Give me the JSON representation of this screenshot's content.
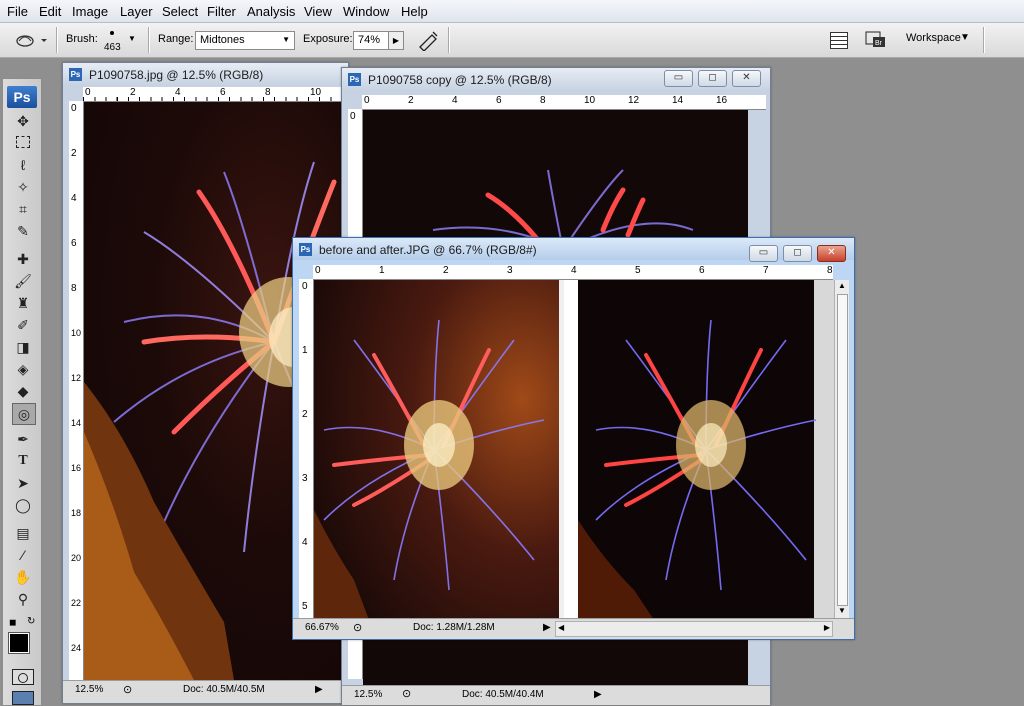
{
  "menu": [
    "File",
    "Edit",
    "Image",
    "Layer",
    "Select",
    "Filter",
    "Analysis",
    "View",
    "Window",
    "Help"
  ],
  "options": {
    "brush_label": "Brush:",
    "brush_size": "463",
    "range_label": "Range:",
    "range_value": "Midtones",
    "exposure_label": "Exposure:",
    "exposure_value": "74%",
    "workspace_label": "Workspace"
  },
  "toolbox": {
    "logo": "Ps"
  },
  "windows": {
    "win1": {
      "title": "P1090758.jpg @ 12.5% (RGB/8)",
      "ruler_h": [
        "0",
        "2",
        "4",
        "6",
        "8",
        "10"
      ],
      "ruler_v": [
        "0",
        "2",
        "4",
        "6",
        "8",
        "10",
        "12",
        "14",
        "16",
        "18",
        "20",
        "22",
        "24"
      ],
      "zoom": "12.5%",
      "doc": "Doc: 40.5M/40.5M"
    },
    "win2": {
      "title": "P1090758 copy @ 12.5% (RGB/8)",
      "ruler_h": [
        "0",
        "2",
        "4",
        "6",
        "8",
        "10",
        "12",
        "14",
        "16"
      ],
      "ruler_v": [
        "0"
      ],
      "zoom": "12.5%",
      "doc": "Doc: 40.5M/40.4M"
    },
    "win3": {
      "title": "before and after.JPG @ 66.7% (RGB/8#)",
      "ruler_h": [
        "0",
        "1",
        "2",
        "3",
        "4",
        "5",
        "6",
        "7",
        "8"
      ],
      "ruler_v": [
        "0",
        "1",
        "2",
        "3",
        "4",
        "5"
      ],
      "zoom": "66.67%",
      "doc": "Doc: 1.28M/1.28M"
    }
  },
  "colors": {
    "accent": "#2c67b5",
    "close": "#c6412b",
    "sky": "#1a0b08"
  }
}
